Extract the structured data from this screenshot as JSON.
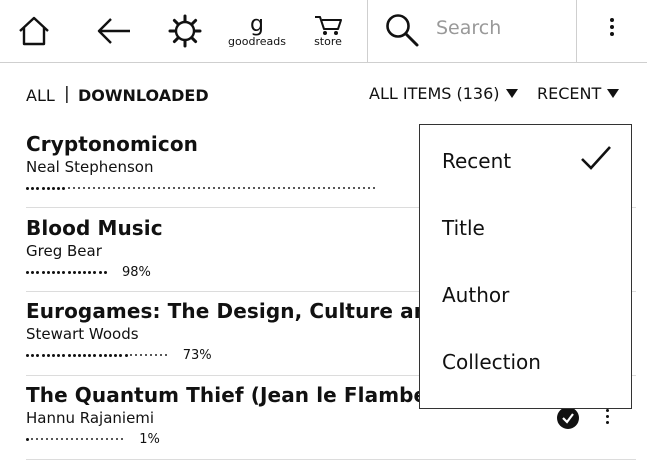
{
  "toolbar": {
    "home_icon": "home-icon",
    "back_icon": "back-arrow-icon",
    "settings_icon": "gear-icon",
    "goodreads_glyph": "g",
    "goodreads_label": "goodreads",
    "store_label": "store",
    "search_placeholder": "Search",
    "menu_icon": "vertical-dots-icon"
  },
  "filters": {
    "all_label": "ALL",
    "separator": "|",
    "downloaded_label": "DOWNLOADED",
    "items_label": "ALL ITEMS (136)",
    "sort_label": "RECENT"
  },
  "books": [
    {
      "title": "Cryptonomicon",
      "author": "Neal Stephenson",
      "progress_fraction": 0.12,
      "percent": ""
    },
    {
      "title": "Blood Music",
      "author": "Greg Bear",
      "progress_fraction": 0.98,
      "percent": "98%"
    },
    {
      "title": "Eurogames: The Design, Culture and P",
      "author": "Stewart Woods",
      "progress_fraction": 0.73,
      "percent": "73%"
    },
    {
      "title": "The Quantum Thief (Jean le Flambeur",
      "author": "Hannu Rajaniemi",
      "progress_fraction": 0.01,
      "percent": "1%"
    }
  ],
  "sort_menu": {
    "items": [
      "Recent",
      "Title",
      "Author",
      "Collection"
    ],
    "selected": "Recent"
  }
}
